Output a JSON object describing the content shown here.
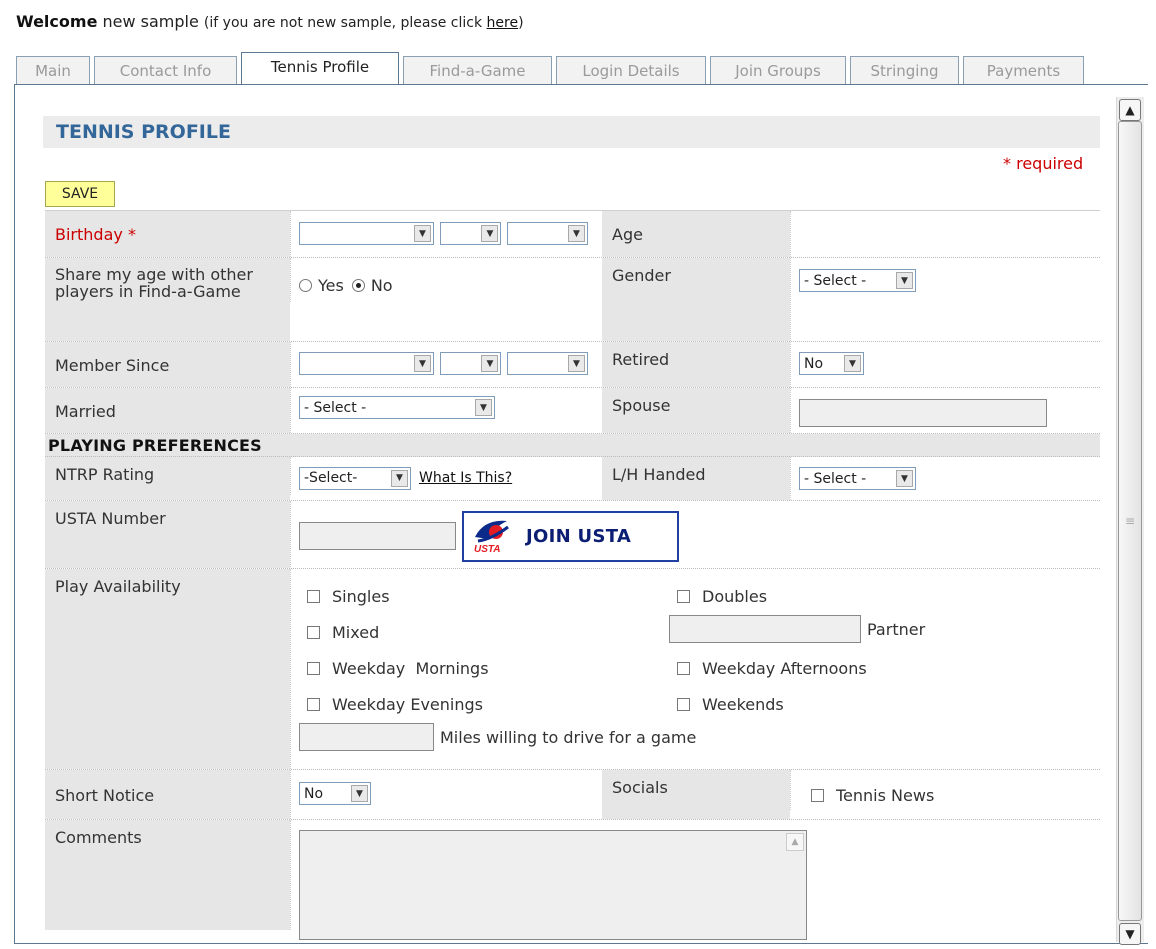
{
  "welcome": {
    "bold": "Welcome",
    "name": " new sample ",
    "notice_prefix": "(if you are not new sample, please click ",
    "link": "here",
    "notice_suffix": ")"
  },
  "tabs": [
    {
      "label": "Main"
    },
    {
      "label": "Contact Info"
    },
    {
      "label": "Tennis Profile",
      "active": true
    },
    {
      "label": "Find-a-Game"
    },
    {
      "label": "Login Details"
    },
    {
      "label": "Join Groups"
    },
    {
      "label": "Stringing"
    },
    {
      "label": "Payments"
    }
  ],
  "section_title": "TENNIS PROFILE",
  "required_note": "* required",
  "save_label": "SAVE",
  "form": {
    "birthday_label": "Birthday",
    "birthday_star": "*",
    "age_label": "Age",
    "share_age_label": "Share my age with other players in Find-a-Game",
    "yes_label": "Yes",
    "no_label": "No",
    "share_age_value": "No",
    "gender_label": "Gender",
    "gender_value": "- Select -",
    "member_since_label": "Member Since",
    "retired_label": "Retired",
    "retired_value": "No",
    "married_label": "Married",
    "married_value": "- Select -",
    "spouse_label": "Spouse",
    "playing_prefs": "PLAYING PREFERENCES",
    "ntrp_label": "NTRP Rating",
    "ntrp_value": "-Select-",
    "what_is_this": "What Is This?",
    "handed_label": "L/H Handed",
    "handed_value": "- Select -",
    "usta_number_label": "USTA Number",
    "join_usta": "JOIN USTA",
    "usta_logo_text": "USTA",
    "play_availability_label": "Play Availability",
    "singles": "Singles",
    "doubles": "Doubles",
    "mixed": "Mixed",
    "partner": "Partner",
    "weekday_mornings": "Weekday  Mornings",
    "weekday_afternoons": "Weekday Afternoons",
    "weekday_evenings": "Weekday Evenings",
    "weekends": "Weekends",
    "miles_label": "Miles willing to drive for a game",
    "short_notice_label": "Short Notice",
    "short_notice_value": "No",
    "socials_label": "Socials",
    "tennis_news": "Tennis News",
    "comments_label": "Comments"
  },
  "colors": {
    "title_blue": "#336699",
    "required_red": "#cc0000",
    "save_yellow": "#ffff99",
    "label_gray": "#e6e6e6"
  }
}
